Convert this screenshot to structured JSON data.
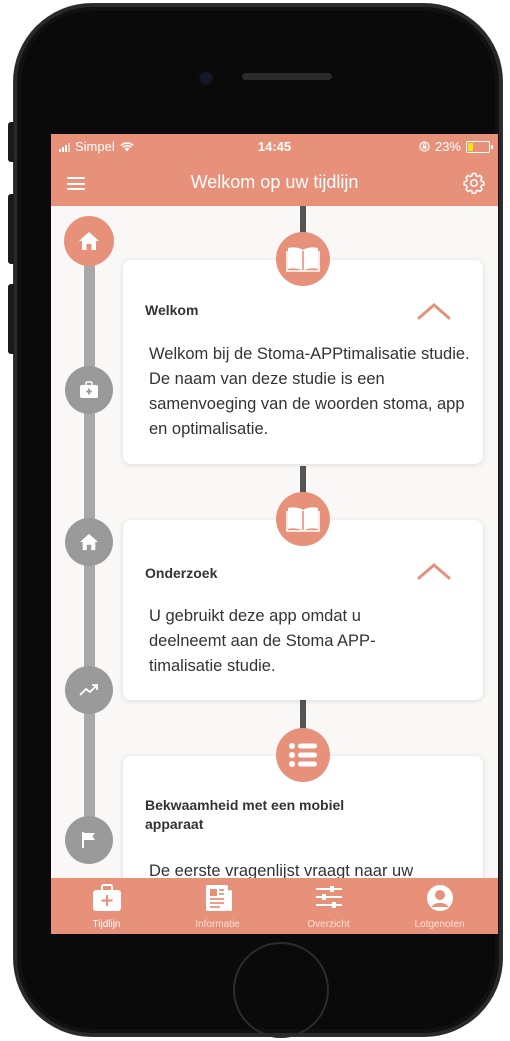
{
  "status": {
    "carrier": "Simpel",
    "time": "14:45",
    "battery": "23%",
    "battery_level": 0.23
  },
  "nav": {
    "title": "Welkom op uw tijdlijn",
    "menu_icon": "hamburger-menu-icon",
    "settings_icon": "gear-icon"
  },
  "timeline_nodes": [
    {
      "icon": "home-icon",
      "state": "active"
    },
    {
      "icon": "medical-kit-icon",
      "state": "inactive"
    },
    {
      "icon": "home-icon",
      "state": "inactive"
    },
    {
      "icon": "trend-icon",
      "state": "inactive"
    },
    {
      "icon": "flag-icon",
      "state": "inactive"
    }
  ],
  "cards": [
    {
      "icon": "book-icon",
      "title": "Welkom",
      "body": "Welkom bij de Stoma-APPtimalisatie studie. De naam van deze studie is een samenvoeging van de woorden stoma, app en optimalisatie.",
      "expanded": true
    },
    {
      "icon": "book-icon",
      "title": "Onderzoek",
      "body": "U gebruikt deze app omdat u deelneemt aan de Stoma APP-timalisatie studie.",
      "expanded": true
    },
    {
      "icon": "list-icon",
      "title": "Bekwaamheid met een mobiel apparaat",
      "body": "De eerste vragenlijst vraagt naar uw"
    }
  ],
  "tabs": [
    {
      "label": "Tijdlijn",
      "icon": "medical-kit-icon",
      "active": true
    },
    {
      "label": "Informatie",
      "icon": "newspaper-icon",
      "active": false
    },
    {
      "label": "Overzicht",
      "icon": "sliders-icon",
      "active": false
    },
    {
      "label": "Lotgenoten",
      "icon": "user-circle-icon",
      "active": false
    }
  ],
  "colors": {
    "accent": "#e8917a",
    "rail": "#a8a8a8",
    "background": "#faf8f6"
  }
}
